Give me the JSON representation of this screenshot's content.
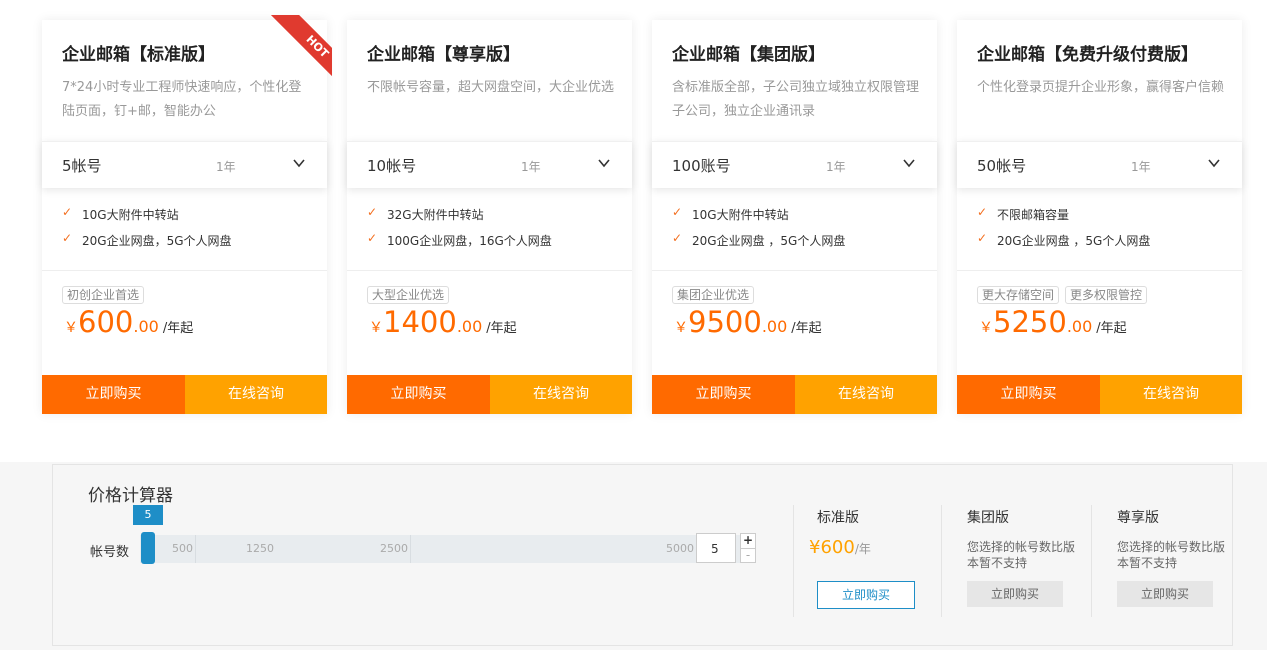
{
  "plans": [
    {
      "title": "企业邮箱【标准版】",
      "desc": "7*24小时专业工程师快速响应，个性化登陆页面，钉+邮，智能办公",
      "accounts": "5帐号",
      "period": "1年",
      "features": [
        "10G大附件中转站",
        "20G企业网盘，5G个人网盘"
      ],
      "tags": [
        "初创企业首选"
      ],
      "currency": "￥",
      "price": "600",
      "decimal": ".00",
      "unit": "/年起",
      "buy": "立即购买",
      "consult": "在线咨询",
      "badge": "HOT"
    },
    {
      "title": "企业邮箱【尊享版】",
      "desc": "不限帐号容量，超大网盘空间，大企业优选",
      "accounts": "10帐号",
      "period": "1年",
      "features": [
        "32G大附件中转站",
        "100G企业网盘，16G个人网盘"
      ],
      "tags": [
        "大型企业优选"
      ],
      "currency": "￥",
      "price": "1400",
      "decimal": ".00",
      "unit": "/年起",
      "buy": "立即购买",
      "consult": "在线咨询"
    },
    {
      "title": "企业邮箱【集团版】",
      "desc": "含标准版全部，子公司独立域独立权限管理子公司，独立企业通讯录",
      "accounts": "100账号",
      "period": "1年",
      "features": [
        "10G大附件中转站",
        "20G企业网盘 ，5G个人网盘"
      ],
      "tags": [
        "集团企业优选"
      ],
      "currency": "￥",
      "price": "9500",
      "decimal": ".00",
      "unit": "/年起",
      "buy": "立即购买",
      "consult": "在线咨询"
    },
    {
      "title": "企业邮箱【免费升级付费版】",
      "desc": "个性化登录页提升企业形象，赢得客户信赖",
      "accounts": "50帐号",
      "period": "1年",
      "features": [
        "不限邮箱容量",
        "20G企业网盘 ，5G个人网盘"
      ],
      "tags": [
        "更大存储空间",
        "更多权限管控"
      ],
      "currency": "￥",
      "price": "5250",
      "decimal": ".00",
      "unit": "/年起",
      "buy": "立即购买",
      "consult": "在线咨询"
    }
  ],
  "calculator": {
    "title": "价格计算器",
    "label": "帐号数",
    "value": "5",
    "ticks": [
      "500",
      "1250",
      "2500",
      "5000"
    ],
    "plus": "+",
    "minus": "-",
    "editions": {
      "standard": {
        "name": "标准版",
        "currency": "¥",
        "price": "600",
        "unit": "/年",
        "buy": "立即购买"
      },
      "group": {
        "name": "集团版",
        "note": "您选择的帐号数比版本暂不支持",
        "buy": "立即购买"
      },
      "premium": {
        "name": "尊享版",
        "note": "您选择的帐号数比版本暂不支持",
        "buy": "立即购买"
      }
    }
  },
  "colors": {
    "buy": "#ff6a00",
    "consult": "#ffa200",
    "accent": "#1e8ec7",
    "hot": "#e03a2f"
  }
}
